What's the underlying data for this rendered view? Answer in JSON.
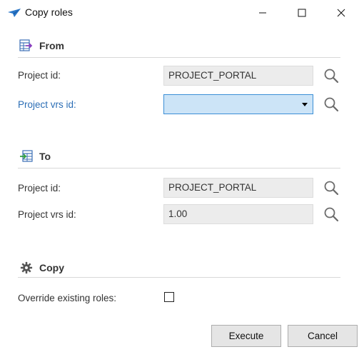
{
  "window": {
    "title": "Copy roles",
    "icons": {
      "app": "app-icon",
      "minimize": "minimize-icon",
      "maximize": "maximize-icon",
      "close": "close-icon"
    }
  },
  "from": {
    "title": "From",
    "icon": "table-import-icon",
    "project_id_label": "Project id:",
    "project_id_value": "PROJECT_PORTAL",
    "project_vrs_label": "Project vrs id:",
    "project_vrs_value": ""
  },
  "to": {
    "title": "To",
    "icon": "table-export-icon",
    "project_id_label": "Project id:",
    "project_id_value": "PROJECT_PORTAL",
    "project_vrs_label": "Project vrs id:",
    "project_vrs_value": "1.00"
  },
  "copy": {
    "title": "Copy",
    "icon": "gear-icon",
    "override_label": "Override existing roles:",
    "override_checked": false
  },
  "buttons": {
    "execute": "Execute",
    "cancel": "Cancel"
  },
  "colors": {
    "active_label": "#2a6db5",
    "focused_field_bg": "#cce4f7",
    "focused_field_border": "#3b8fd6",
    "readonly_field_bg": "#ececec"
  }
}
